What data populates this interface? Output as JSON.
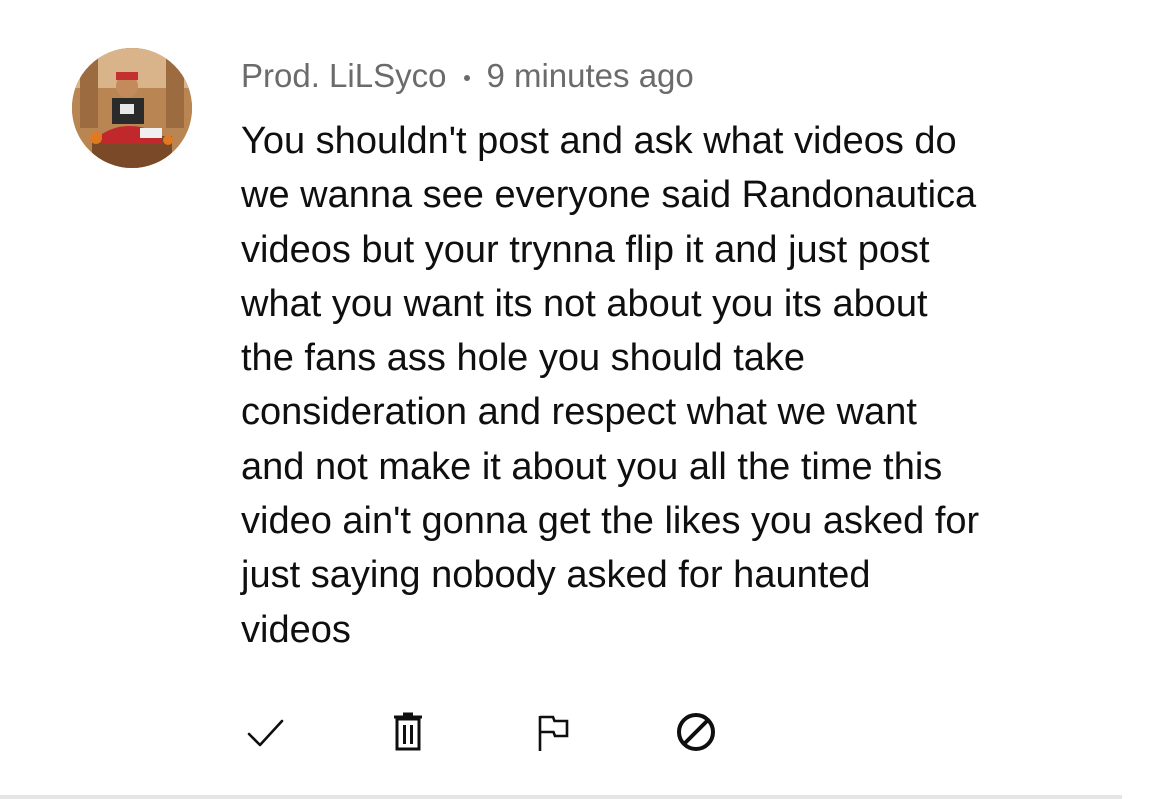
{
  "comment": {
    "author": "Prod. LiLSyco",
    "separator": "•",
    "timestamp": "9 minutes ago",
    "text_lines": [
      "You shouldn't post and ask what videos do",
      "we wanna see everyone said Randonautica",
      "videos but your trynna flip it and just post",
      "what you want its not about you its about",
      "the fans ass hole you should take",
      "consideration and respect what we want",
      "and not make it about you all the time this",
      "video ain't gonna get the likes you asked for",
      "just saying nobody asked for haunted",
      "videos"
    ]
  },
  "actions": [
    {
      "name": "approve",
      "icon": "checkmark-icon"
    },
    {
      "name": "delete",
      "icon": "trash-icon"
    },
    {
      "name": "report",
      "icon": "flag-icon"
    },
    {
      "name": "block",
      "icon": "block-icon"
    }
  ],
  "colors": {
    "text_primary": "#0f0f0f",
    "text_secondary": "#6b6b6b",
    "background": "#ffffff",
    "divider": "#e5e5e5"
  }
}
